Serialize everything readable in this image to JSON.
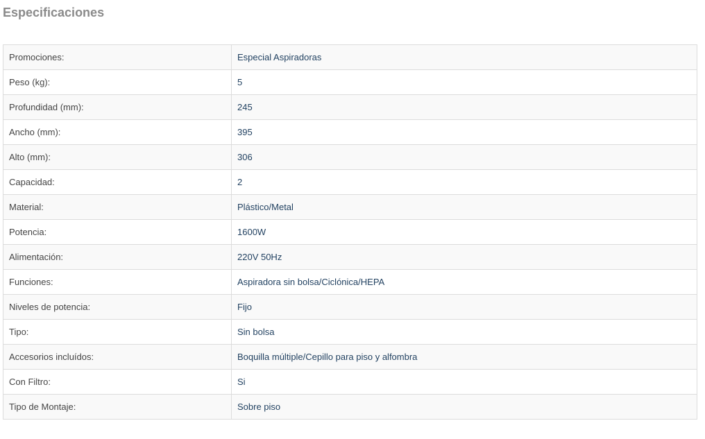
{
  "page": {
    "title": "Especificaciones"
  },
  "specs": [
    {
      "label": "Promociones:",
      "value": "Especial Aspiradoras"
    },
    {
      "label": "Peso (kg):",
      "value": "5"
    },
    {
      "label": "Profundidad (mm):",
      "value": "245"
    },
    {
      "label": "Ancho (mm):",
      "value": "395"
    },
    {
      "label": "Alto (mm):",
      "value": "306"
    },
    {
      "label": "Capacidad:",
      "value": "2"
    },
    {
      "label": "Material:",
      "value": "Plástico/Metal"
    },
    {
      "label": "Potencia:",
      "value": "1600W"
    },
    {
      "label": "Alimentación:",
      "value": "220V 50Hz"
    },
    {
      "label": "Funciones:",
      "value": "Aspiradora sin bolsa/Ciclónica/HEPA"
    },
    {
      "label": "Niveles de potencia:",
      "value": "Fijo"
    },
    {
      "label": "Tipo:",
      "value": "Sin bolsa"
    },
    {
      "label": "Accesorios incluídos:",
      "value": "Boquilla múltiple/Cepillo para piso y alfombra"
    },
    {
      "label": "Con Filtro:",
      "value": "Si"
    },
    {
      "label": "Tipo de Montaje:",
      "value": "Sobre piso"
    }
  ],
  "colors": {
    "title": "#8a8a8a",
    "label_text": "#444444",
    "value_text": "#1f3f5f",
    "row_odd": "#f9f9f9",
    "row_even": "#ffffff",
    "border": "#dcdcdc"
  }
}
